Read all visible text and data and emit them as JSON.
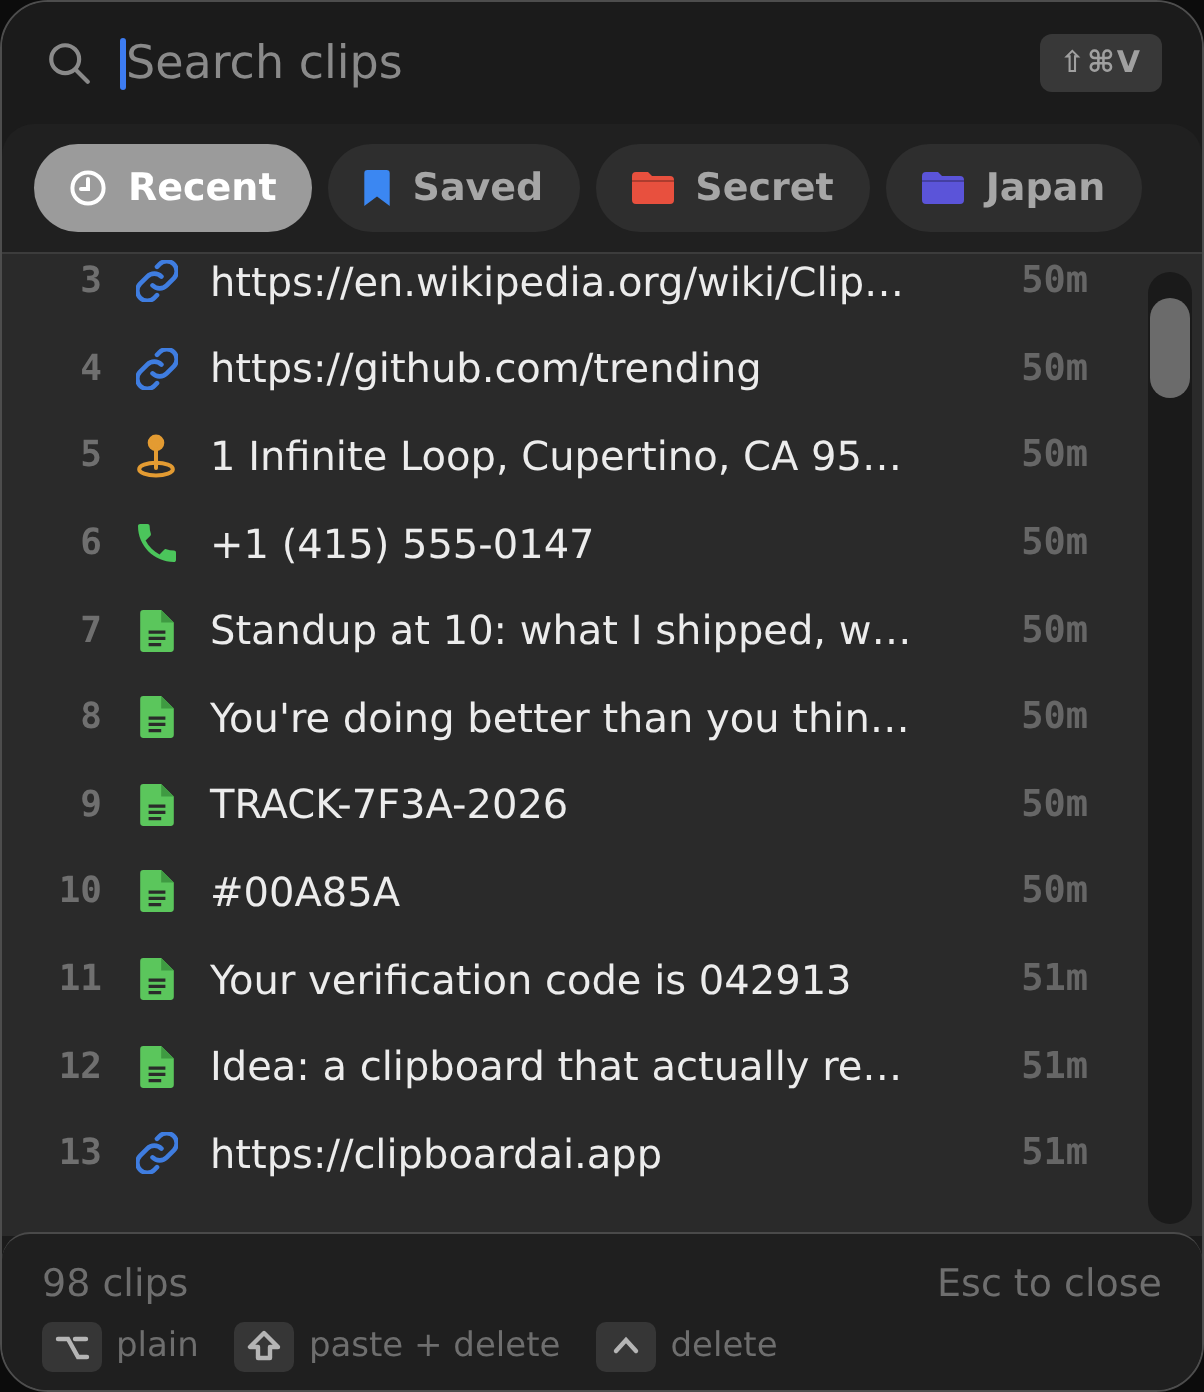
{
  "search": {
    "placeholder": "Search clips",
    "shortcut": "⇧⌘V"
  },
  "tabs": [
    {
      "label": "Recent",
      "kind": "recent",
      "selected": true
    },
    {
      "label": "Saved",
      "kind": "saved",
      "color": "#3b87f2",
      "selected": false
    },
    {
      "label": "Secret",
      "kind": "folder",
      "color": "#e8503e",
      "selected": false
    },
    {
      "label": "Japan",
      "kind": "folder",
      "color": "#5b54d9",
      "selected": false
    }
  ],
  "clips": [
    {
      "number": "3",
      "kind": "link",
      "text": "https://en.wikipedia.org/wiki/Clip…",
      "age": "50m"
    },
    {
      "number": "4",
      "kind": "link",
      "text": "https://github.com/trending",
      "age": "50m"
    },
    {
      "number": "5",
      "kind": "location",
      "text": "1 Infinite Loop, Cupertino, CA 95…",
      "age": "50m"
    },
    {
      "number": "6",
      "kind": "phone",
      "text": "+1 (415) 555-0147",
      "age": "50m"
    },
    {
      "number": "7",
      "kind": "text",
      "text": "Standup at 10: what I shipped, w…",
      "age": "50m"
    },
    {
      "number": "8",
      "kind": "text",
      "text": "You're doing better than you thin…",
      "age": "50m"
    },
    {
      "number": "9",
      "kind": "text",
      "text": "TRACK-7F3A-2026",
      "age": "50m"
    },
    {
      "number": "10",
      "kind": "text",
      "text": "#00A85A",
      "age": "50m"
    },
    {
      "number": "11",
      "kind": "text",
      "text": "Your verification code is 042913",
      "age": "51m"
    },
    {
      "number": "12",
      "kind": "text",
      "text": "Idea: a clipboard that actually re…",
      "age": "51m"
    },
    {
      "number": "13",
      "kind": "link",
      "text": "https://clipboardai.app",
      "age": "51m"
    }
  ],
  "footer": {
    "count": "98 clips",
    "close_hint": "Esc to close",
    "hints": [
      {
        "kind": "option",
        "label": "plain"
      },
      {
        "kind": "shift",
        "label": "paste + delete"
      },
      {
        "kind": "control",
        "label": "delete"
      }
    ]
  }
}
